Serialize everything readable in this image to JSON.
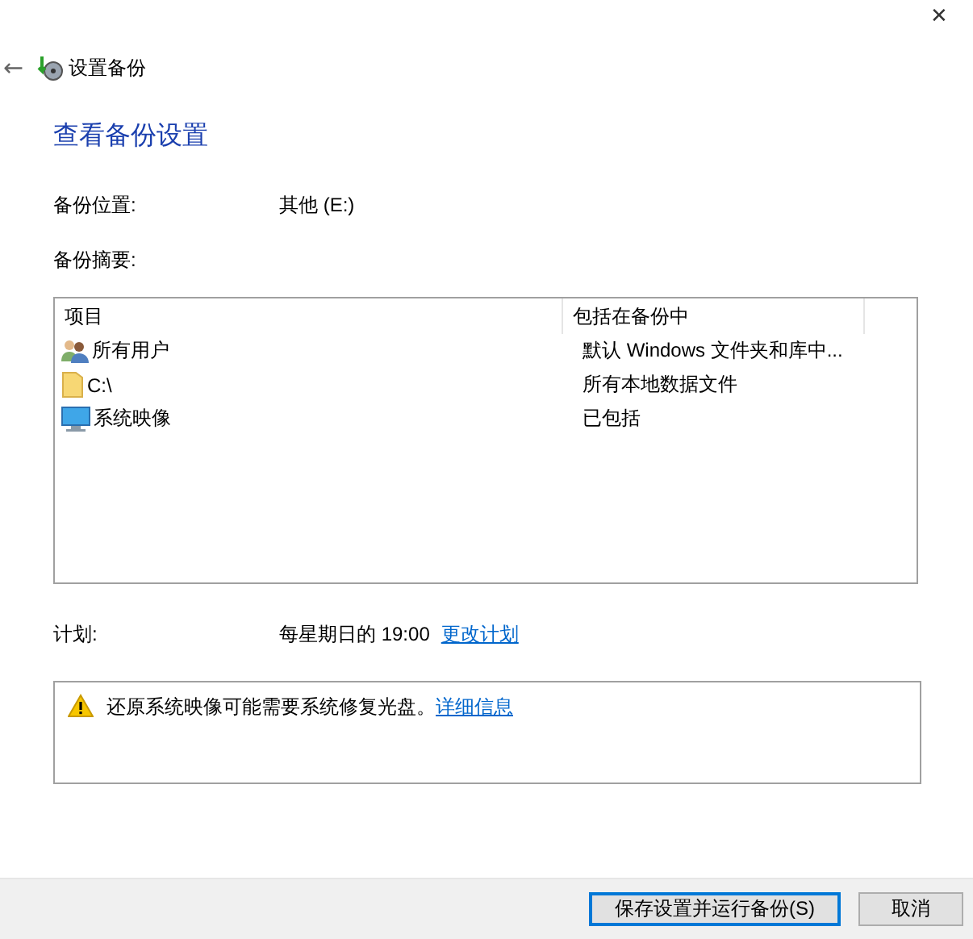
{
  "window": {
    "close": "✕"
  },
  "nav": {
    "back": "←",
    "title": "设置备份"
  },
  "heading": "查看备份设置",
  "location": {
    "label": "备份位置:",
    "value": "其他 (E:)"
  },
  "summary": {
    "label": "备份摘要:"
  },
  "table": {
    "columns": [
      "项目",
      "包括在备份中"
    ],
    "rows": [
      {
        "kind": "users",
        "item": "所有用户",
        "included": "默认 Windows 文件夹和库中..."
      },
      {
        "kind": "folder",
        "item": "C:\\",
        "included": "所有本地数据文件"
      },
      {
        "kind": "monitor",
        "item": "系统映像",
        "included": "已包括"
      }
    ]
  },
  "schedule": {
    "label": "计划:",
    "value": "每星期日的 19:00",
    "link": "更改计划"
  },
  "warning": {
    "text": "还原系统映像可能需要系统修复光盘。",
    "link": "详细信息"
  },
  "buttons": [
    {
      "label": "保存设置并运行备份(S)",
      "default": true
    },
    {
      "label": "取消",
      "default": false
    }
  ]
}
